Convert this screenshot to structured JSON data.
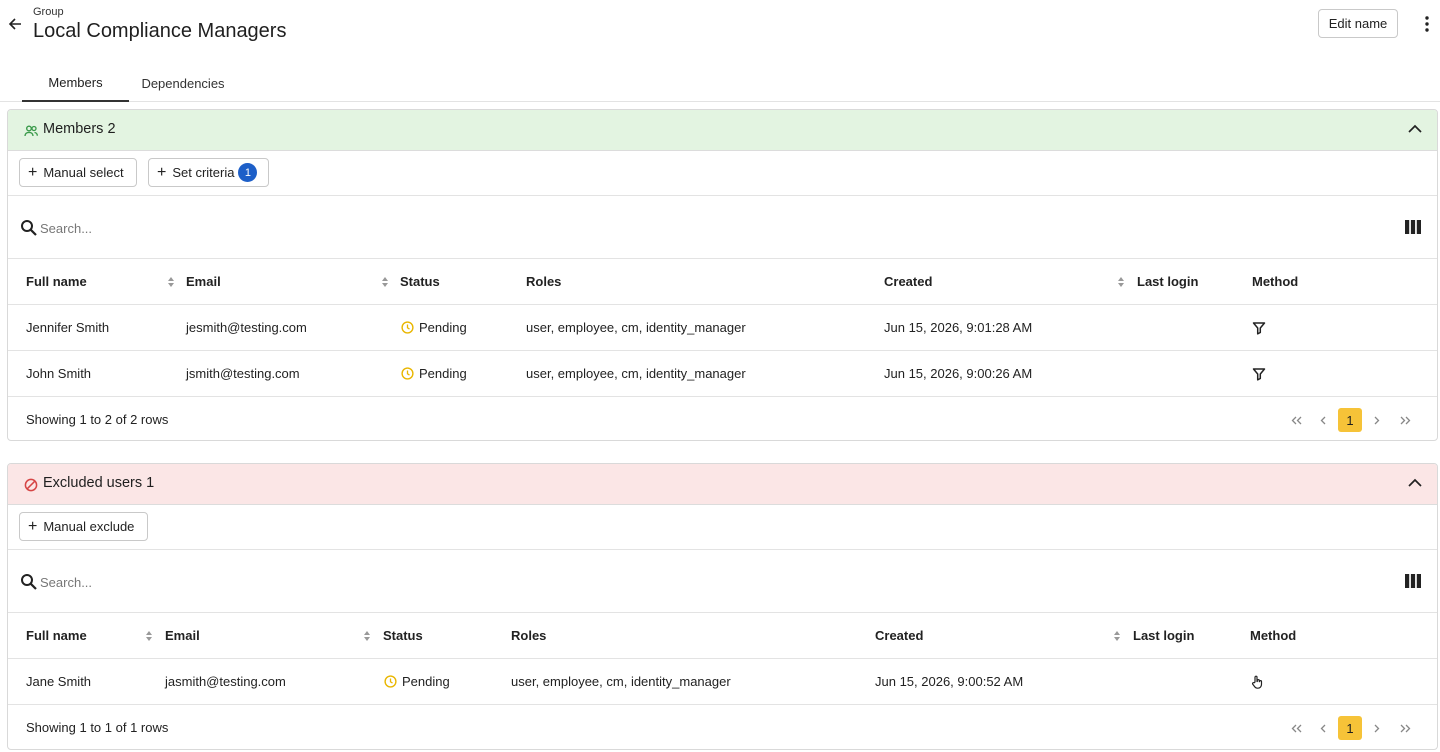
{
  "header": {
    "overline": "Group",
    "title": "Local Compliance Managers",
    "edit_label": "Edit name"
  },
  "tabs": [
    {
      "label": "Members",
      "active": true
    },
    {
      "label": "Dependencies",
      "active": false
    }
  ],
  "members_section": {
    "title": "Members 2",
    "color": "#e3f4e1",
    "buttons": {
      "manual_select": "Manual select",
      "set_criteria": "Set criteria",
      "criteria_count": "1"
    },
    "search_placeholder": "Search...",
    "columns": [
      "Full name",
      "Email",
      "Status",
      "Roles",
      "Created",
      "Last login",
      "Method"
    ],
    "rows": [
      {
        "name": "Jennifer Smith",
        "email": "jesmith@testing.com",
        "status": "Pending",
        "roles": "user, employee, cm, identity_manager",
        "created": "Jun 15, 2026, 9:01:28 AM",
        "last_login": "",
        "method": "filter-icon"
      },
      {
        "name": "John Smith",
        "email": "jsmith@testing.com",
        "status": "Pending",
        "roles": "user, employee, cm, identity_manager",
        "created": "Jun 15, 2026, 9:00:26 AM",
        "last_login": "",
        "method": "filter-icon"
      }
    ],
    "showing": "Showing 1 to 2 of 2 rows",
    "page": "1"
  },
  "excluded_section": {
    "title": "Excluded users 1",
    "color": "#fbe6e6",
    "buttons": {
      "manual_exclude": "Manual exclude"
    },
    "search_placeholder": "Search...",
    "columns": [
      "Full name",
      "Email",
      "Status",
      "Roles",
      "Created",
      "Last login",
      "Method"
    ],
    "rows": [
      {
        "name": "Jane Smith",
        "email": "jasmith@testing.com",
        "status": "Pending",
        "roles": "user, employee, cm, identity_manager",
        "created": "Jun 15, 2026, 9:00:52 AM",
        "last_login": "",
        "method": "hand-pointer-icon"
      }
    ],
    "showing": "Showing 1 to 1 of 1 rows",
    "page": "1"
  },
  "colors": {
    "accent_badge": "#1d5fc8",
    "pagination_current": "#f6c338",
    "pending": "#e9b600",
    "members_icon": "#3a9a4a",
    "excluded_icon": "#d64545"
  }
}
